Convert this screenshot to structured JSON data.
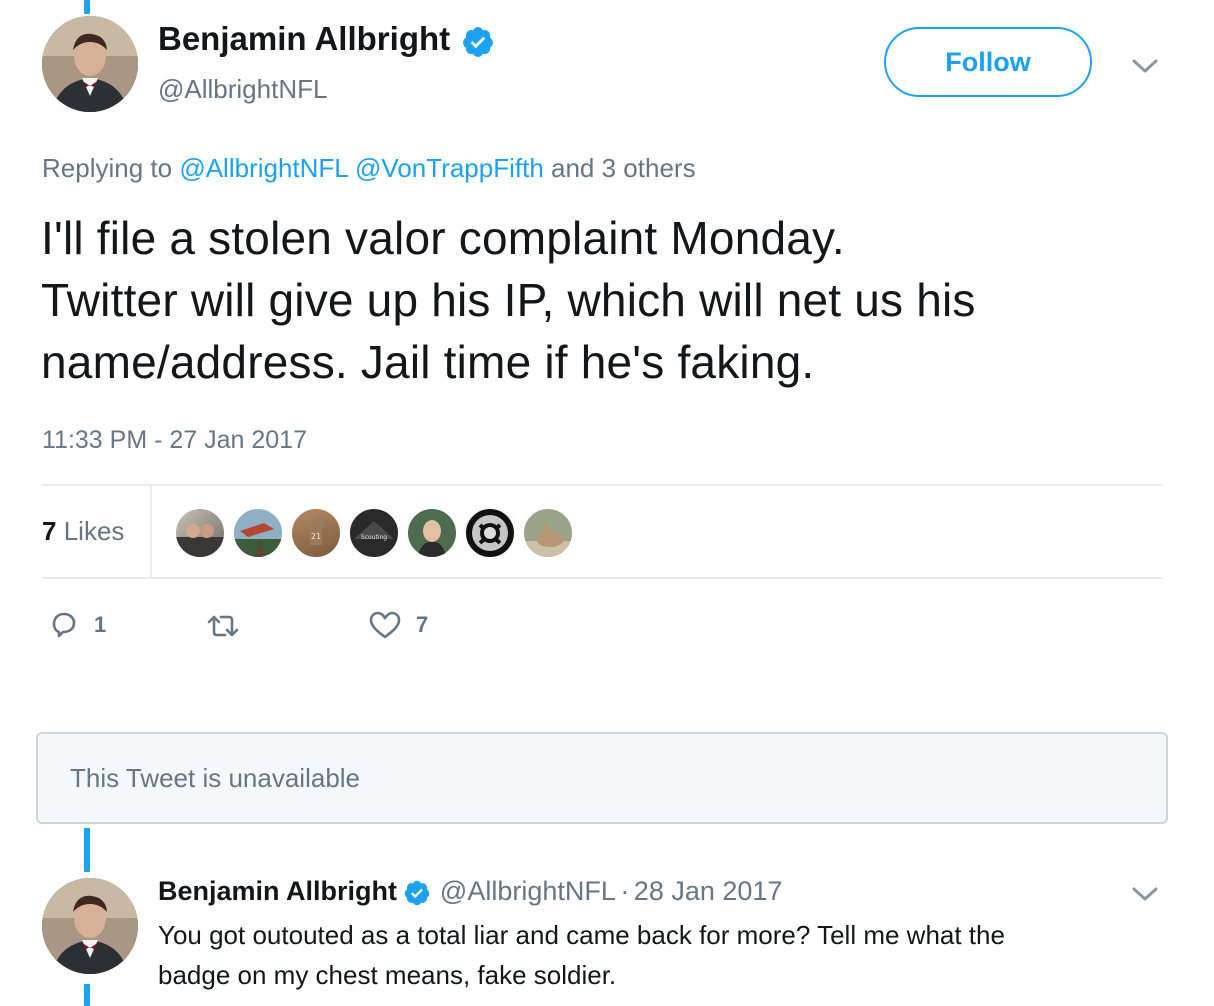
{
  "main_tweet": {
    "author": {
      "name": "Benjamin Allbright",
      "handle": "@AllbrightNFL",
      "verified_icon": "verified-badge-icon"
    },
    "follow_label": "Follow",
    "replying": {
      "prefix": "Replying to",
      "mention1": "@AllbrightNFL",
      "mention2": "@VonTrappFifth",
      "suffix": "and 3 others"
    },
    "text_lines": [
      "I'll file a stolen valor complaint Monday.",
      "Twitter will give up his IP, which will net us his",
      "name/address. Jail time if he's faking."
    ],
    "timestamp": "11:33 PM - 27 Jan 2017",
    "likes": {
      "count": "7",
      "label": "Likes"
    },
    "liker_avatar_text": "Scouting",
    "actions": {
      "reply_count": "1",
      "retweet_count": "",
      "like_count": "7"
    }
  },
  "unavailable_text": "This Tweet is unavailable",
  "reply_tweet": {
    "name": "Benjamin Allbright",
    "handle": "@AllbrightNFL",
    "separator": "·",
    "date": "28 Jan 2017",
    "text_lines": [
      "You got outouted as a total liar and came back for more? Tell me what the",
      "badge on my chest means, fake soldier."
    ]
  },
  "colors": {
    "accent": "#1da1f2",
    "text": "#14171a",
    "muted": "#657786",
    "border": "#e6ecf0"
  }
}
